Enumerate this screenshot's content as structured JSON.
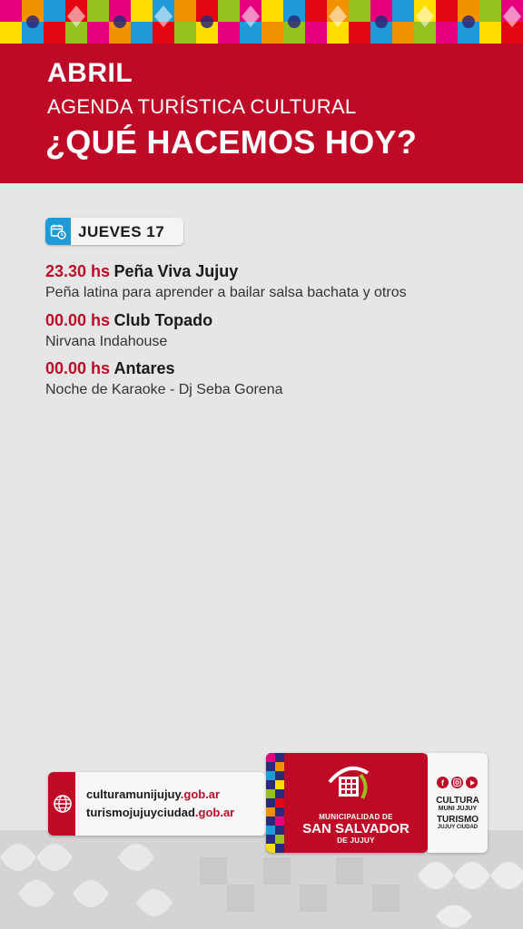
{
  "header": {
    "month": "ABRIL",
    "subtitle": "AGENDA TURÍSTICA CULTURAL",
    "title": "¿QUÉ HACEMOS HOY?"
  },
  "day": {
    "label": "JUEVES 17",
    "icon": "calendar-clock-icon"
  },
  "events": [
    {
      "time": "23.30 hs",
      "place": "Peña Viva Jujuy",
      "desc": "Peña latina para aprender a bailar salsa bachata y otros"
    },
    {
      "time": "00.00 hs",
      "place": "Club Topado",
      "desc": "Nirvana Indahouse"
    },
    {
      "time": "00.00 hs",
      "place": "Antares",
      "desc": "Noche de Karaoke - Dj Seba Gorena"
    }
  ],
  "websites": [
    {
      "name": "culturamunijujuy",
      "domain": ".gob.ar"
    },
    {
      "name": "turismojujuyciudad",
      "domain": ".gob.ar"
    }
  ],
  "muni": {
    "line1": "MUNICIPALIDAD DE",
    "line2": "SAN SALVADOR",
    "line3": "DE JUJUY"
  },
  "social": {
    "cultura": "CULTURA",
    "cultura_sub": "MUNI JUJUY",
    "turismo": "TURISMO",
    "turismo_sub": "JUJUY CIUDAD",
    "icons": [
      "facebook-icon",
      "instagram-icon",
      "youtube-icon"
    ]
  },
  "colors": {
    "brand_red": "#be0a26",
    "accent_blue": "#1e9ad6",
    "background": "#e6e6e6"
  }
}
